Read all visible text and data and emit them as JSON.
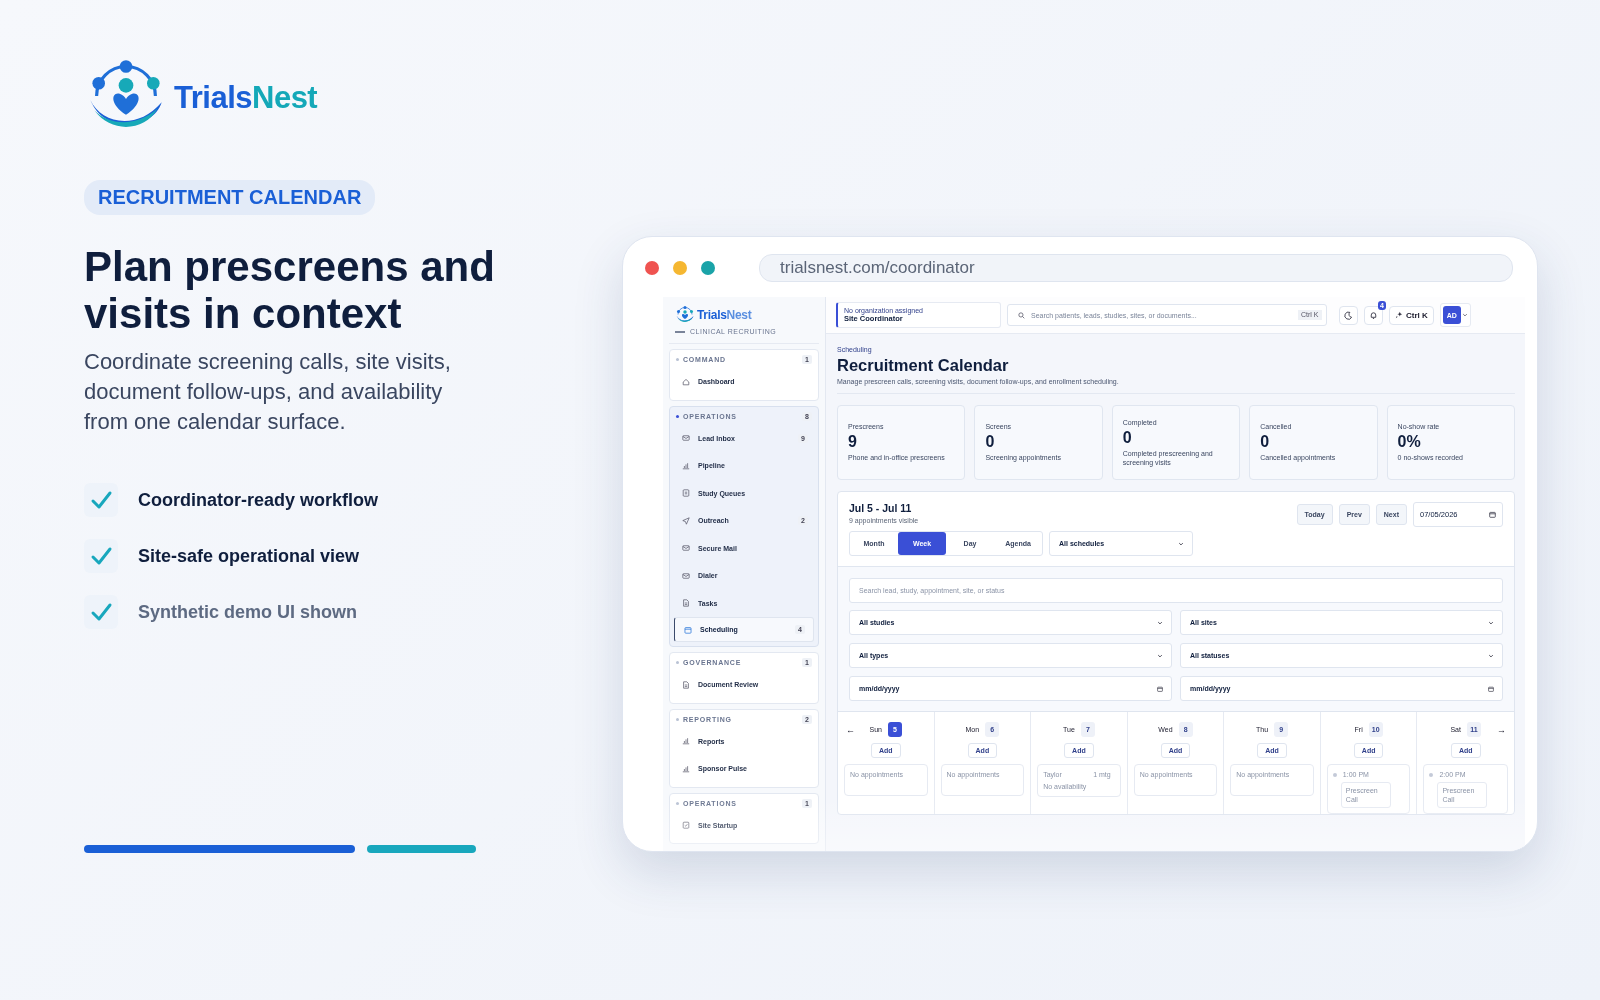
{
  "brand": {
    "name_start": "Trials",
    "name_end": "Nest"
  },
  "eyebrow": "RECRUITMENT CALENDAR",
  "headline": "Plan prescreens and visits in context",
  "intro": "Coordinate screening calls, site visits, document follow-ups, and availability from one calendar surface.",
  "features": [
    {
      "label": "Coordinator-ready workflow",
      "muted": false
    },
    {
      "label": "Site-safe operational view",
      "muted": false
    },
    {
      "label": "Synthetic demo UI shown",
      "muted": true
    }
  ],
  "browser": {
    "url": "trialsnest.com/coordinator"
  },
  "sidebar": {
    "brand_start": "Trials",
    "brand_end": "Nest",
    "tagline": "CLINICAL RECRUITING",
    "groups": [
      {
        "title": "COMMAND",
        "count": "1",
        "active": false,
        "items": [
          {
            "label": "Dashboard",
            "selected": false
          }
        ]
      },
      {
        "title": "OPERATIONS",
        "count": "8",
        "active": true,
        "items": [
          {
            "label": "Lead Inbox",
            "count": "9",
            "selected": false
          },
          {
            "label": "Pipeline",
            "selected": false
          },
          {
            "label": "Study Queues",
            "selected": false
          },
          {
            "label": "Outreach",
            "count": "2",
            "selected": false
          },
          {
            "label": "Secure Mail",
            "selected": false
          },
          {
            "label": "Dialer",
            "selected": false
          },
          {
            "label": "Tasks",
            "selected": false
          },
          {
            "label": "Scheduling",
            "count": "4",
            "selected": true
          }
        ]
      },
      {
        "title": "GOVERNANCE",
        "count": "1",
        "active": false,
        "items": [
          {
            "label": "Document Review",
            "selected": false
          }
        ]
      },
      {
        "title": "REPORTING",
        "count": "2",
        "active": false,
        "items": [
          {
            "label": "Reports",
            "selected": false
          },
          {
            "label": "Sponsor Pulse",
            "selected": false
          }
        ]
      },
      {
        "title": "OPERATIONS",
        "count": "1",
        "active": false,
        "items": [
          {
            "label": "Site Startup",
            "selected": false
          }
        ]
      }
    ]
  },
  "topbar": {
    "org_note": "No organization assigned",
    "role": "Site Coordinator",
    "search_placeholder": "Search patients, leads, studies, sites, or documents...",
    "search_shortcut": "Ctrl K",
    "notifications": "4",
    "command": "Ctrl K",
    "avatar": "AD"
  },
  "page": {
    "breadcrumb": "Scheduling",
    "title": "Recruitment Calendar",
    "subtitle": "Manage prescreen calls, screening visits, document follow-ups, and enrollment scheduling."
  },
  "stats": [
    {
      "label": "Prescreens",
      "value": "9",
      "note": "Phone and in-office prescreens"
    },
    {
      "label": "Screens",
      "value": "0",
      "note": "Screening appointments"
    },
    {
      "label": "Completed",
      "value": "0",
      "note": "Completed prescreening and screening visits"
    },
    {
      "label": "Cancelled",
      "value": "0",
      "note": "Cancelled appointments"
    },
    {
      "label": "No-show rate",
      "value": "0%",
      "note": "0 no-shows recorded"
    }
  ],
  "calendar": {
    "range": "Jul 5 - Jul 11",
    "count": "9 appointments visible",
    "buttons": [
      "Today",
      "Prev",
      "Next"
    ],
    "date": "07/05/2026",
    "views": [
      {
        "label": "Month",
        "selected": false
      },
      {
        "label": "Week",
        "selected": true
      },
      {
        "label": "Day",
        "selected": false
      },
      {
        "label": "Agenda",
        "selected": false
      }
    ],
    "schedule": "All schedules",
    "search_placeholder": "Search lead, study, appointment, site, or status",
    "filters": [
      "All studies",
      "All sites",
      "All types",
      "All statuses"
    ],
    "date_filters": [
      "mm/dd/yyyy",
      "mm/dd/yyyy"
    ],
    "nav_prev": "←",
    "nav_next": "→",
    "days": [
      {
        "weekday": "Sun",
        "date": "5",
        "selected": true,
        "add": "Add",
        "entries": [
          {
            "kind": "empty",
            "text": "No appointments"
          }
        ]
      },
      {
        "weekday": "Mon",
        "date": "6",
        "selected": false,
        "add": "Add",
        "entries": [
          {
            "kind": "empty",
            "text": "No appointments"
          }
        ]
      },
      {
        "weekday": "Tue",
        "date": "7",
        "selected": false,
        "add": "Add",
        "entries": [
          {
            "kind": "availability",
            "name": "Taylor",
            "meta": "1 mtg",
            "text": "No availability"
          }
        ]
      },
      {
        "weekday": "Wed",
        "date": "8",
        "selected": false,
        "add": "Add",
        "entries": [
          {
            "kind": "empty",
            "text": "No appointments"
          }
        ]
      },
      {
        "weekday": "Thu",
        "date": "9",
        "selected": false,
        "add": "Add",
        "entries": [
          {
            "kind": "empty",
            "text": "No appointments"
          }
        ]
      },
      {
        "weekday": "Fri",
        "date": "10",
        "selected": false,
        "add": "Add",
        "entries": [
          {
            "kind": "event",
            "time": "1:00 PM",
            "text": "Prescreen Call"
          }
        ]
      },
      {
        "weekday": "Sat",
        "date": "11",
        "selected": false,
        "add": "Add",
        "entries": [
          {
            "kind": "event",
            "time": "2:00 PM",
            "text": "Prescreen Call"
          }
        ]
      }
    ]
  }
}
